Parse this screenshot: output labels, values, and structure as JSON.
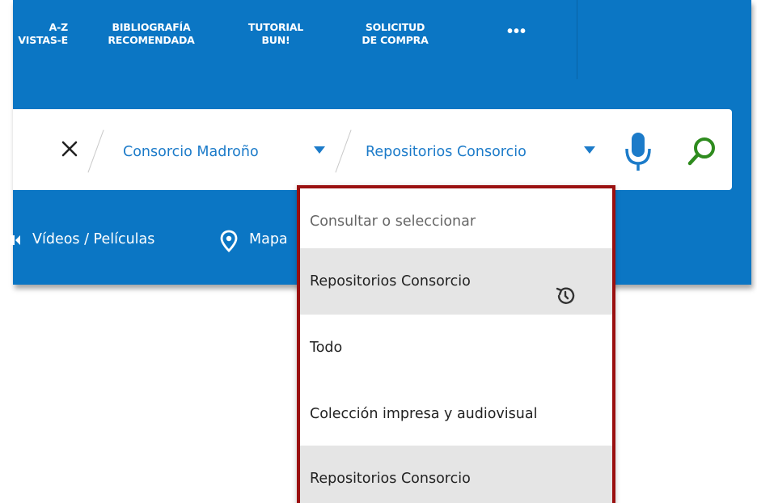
{
  "topnav": {
    "items": [
      {
        "label": "A-Z\nVISTAS-E"
      },
      {
        "label": "BIBLIOGRAFÍA\nRECOMENDADA"
      },
      {
        "label": "TUTORIAL\nBUN!"
      },
      {
        "label": "SOLICITUD\nDE COMPRA"
      }
    ],
    "more_label": "•••"
  },
  "search": {
    "clear_icon": "close-icon",
    "scope_1": "Consorcio Madroño",
    "scope_2": "Repositorios Consorcio",
    "mic_icon": "microphone-icon",
    "search_icon": "search-icon",
    "icon_color": "#1c7bc9",
    "search_icon_color": "#2e8b1e"
  },
  "bottomnav": {
    "items": [
      {
        "label": "Vídeos / Películas",
        "icon": "video-camera-icon"
      },
      {
        "label": "Mapa",
        "icon": "map-pin-icon"
      }
    ]
  },
  "dropdown": {
    "hint": "Consultar o seleccionar",
    "items": [
      {
        "label": "Repositorios Consorcio",
        "icon": "history-icon",
        "highlighted": true
      },
      {
        "label": "Todo",
        "highlighted": false
      },
      {
        "label": "Colección impresa y audiovisual",
        "highlighted": false
      },
      {
        "label": "Repositorios Consorcio",
        "highlighted": true
      }
    ],
    "border_color": "#9a1010"
  },
  "colors": {
    "header_blue": "#0b76c4",
    "link_blue": "#1c7bc9"
  }
}
